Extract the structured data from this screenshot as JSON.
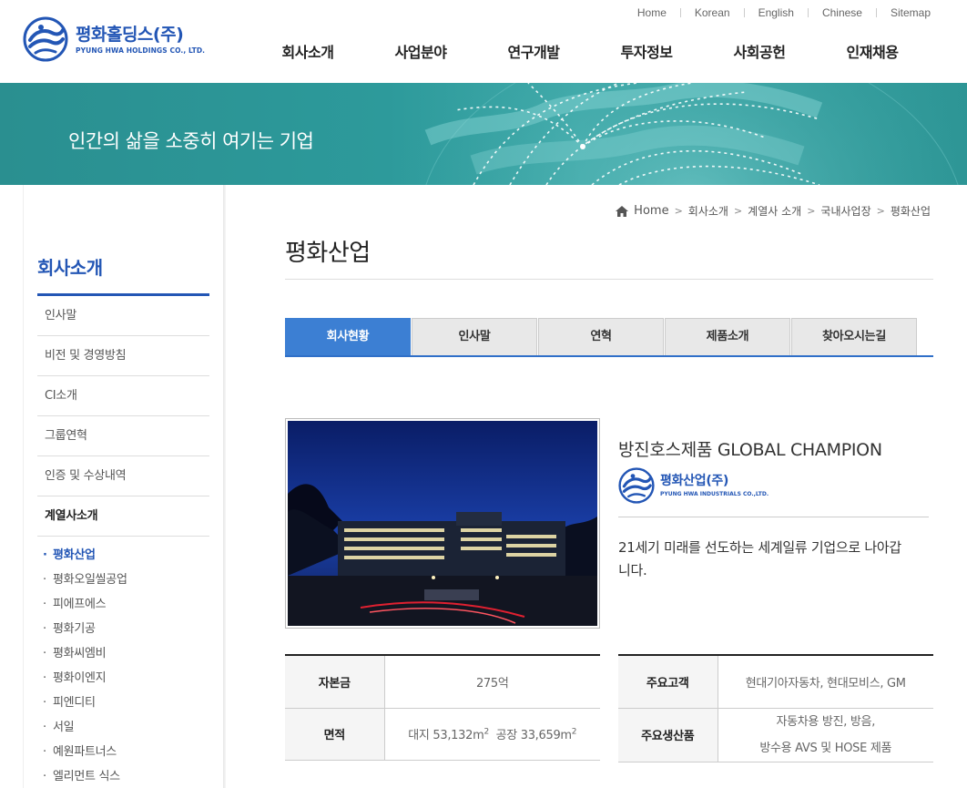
{
  "header": {
    "logo": {
      "name_kr": "평화홀딩스(주)",
      "name_en": "PYUNG HWA HOLDINGS CO., LTD."
    },
    "util_links": [
      "Home",
      "Korean",
      "English",
      "Chinese",
      "Sitemap"
    ],
    "gnb": [
      "회사소개",
      "사업분야",
      "연구개발",
      "투자정보",
      "사회공헌",
      "인재채용"
    ]
  },
  "banner": {
    "slogan": "인간의 삶을 소중히 여기는 기업"
  },
  "sidebar": {
    "title": "회사소개",
    "menu": [
      "인사말",
      "비전 및 경영방침",
      "CI소개",
      "그룹연혁",
      "인증 및 수상내역",
      "계열사소개"
    ],
    "active_menu": "계열사소개",
    "sub_bullet": "·",
    "submenu": [
      "평화산업",
      "평화오일씰공업",
      "피에프에스",
      "평화기공",
      "평화씨엠비",
      "평화이엔지",
      "피엔디티",
      "서일",
      "예원파트너스",
      "엘리먼트 식스"
    ],
    "active_sub": "평화산업"
  },
  "breadcrumb": [
    "Home",
    "회사소개",
    "계열사 소개",
    "국내사업장",
    "평화산업"
  ],
  "page_title": "평화산업",
  "tabs": [
    "회사현황",
    "인사말",
    "연혁",
    "제품소개",
    "찾아오시는길"
  ],
  "active_tab": "회사현황",
  "intro": {
    "headline": "방진호스제품 GLOBAL CHAMPION",
    "company_logo": {
      "name_kr": "평화산업(주)",
      "name_en": "PYUNG HWA INDUSTRIALS CO.,LTD."
    },
    "description": "21세기 미래를 선도하는 세계일류 기업으로 나아갑니다."
  },
  "info_left": {
    "capital_label": "자본금",
    "capital_value": "275억",
    "area_label": "면적",
    "area_site_prefix": "대지 53,132m",
    "area_factory_prefix": "공장 33,659m",
    "area_unit_sup": "2"
  },
  "info_right": {
    "customer_label": "주요고객",
    "customer_value": "현대기아자동차, 현대모비스, GM",
    "product_label": "주요생산품",
    "product_line1": "자동차용 방진, 방음,",
    "product_line2": "방수용 AVS 및 HOSE 제품"
  },
  "colors": {
    "brand_blue": "#2356b5",
    "tab_active": "#3c7fd3",
    "banner_teal": "#2d9a9b"
  }
}
